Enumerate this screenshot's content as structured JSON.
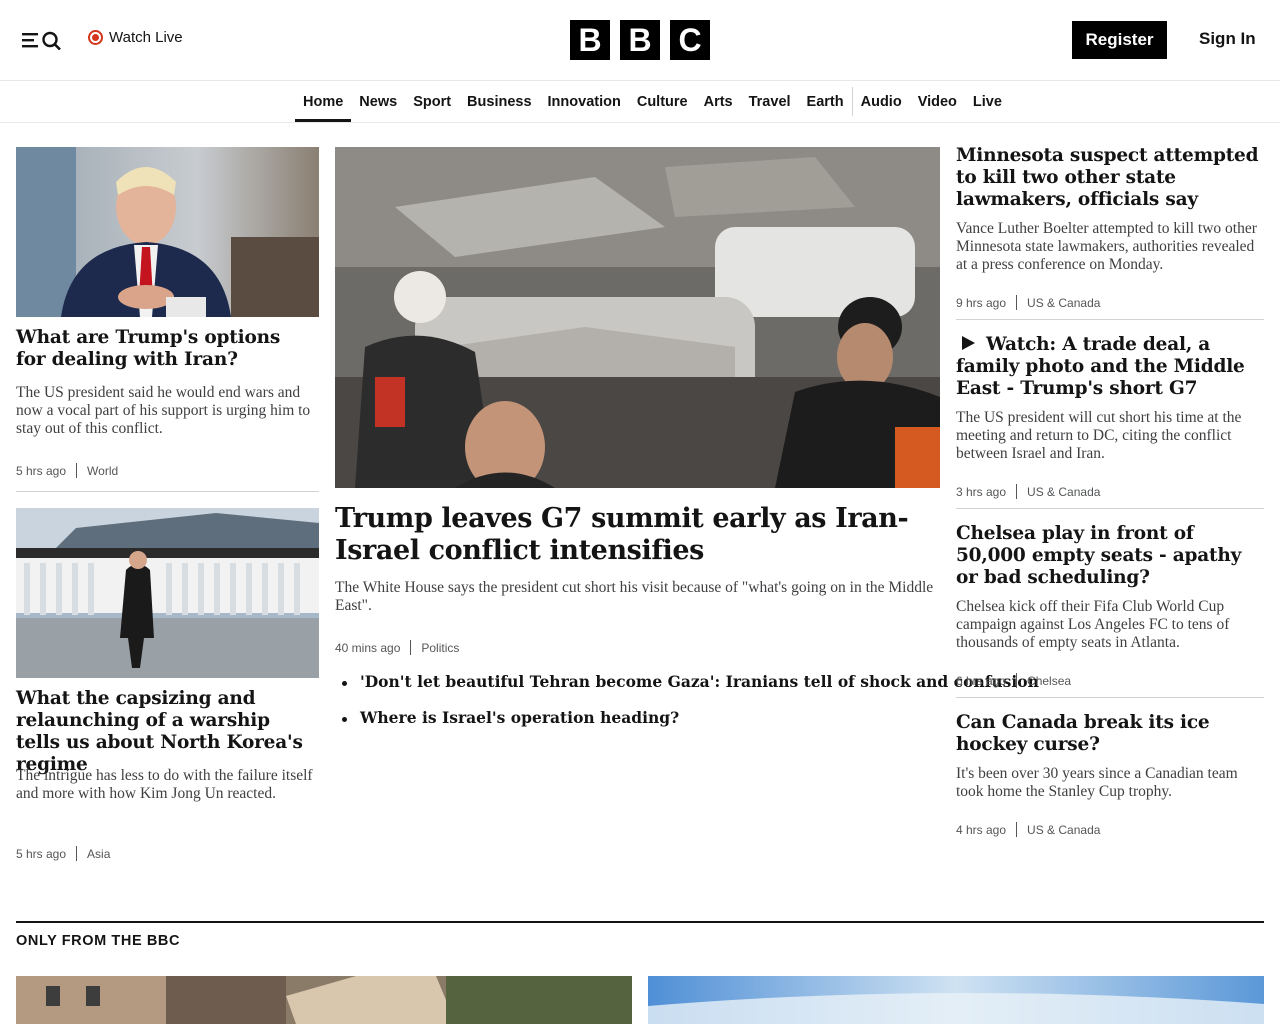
{
  "header": {
    "watch_live": "Watch Live",
    "logo_letters": [
      "B",
      "B",
      "C"
    ],
    "register": "Register",
    "sign_in": "Sign In"
  },
  "nav": {
    "items": [
      "Home",
      "News",
      "Sport",
      "Business",
      "Innovation",
      "Culture",
      "Arts",
      "Travel",
      "Earth",
      "Audio",
      "Video",
      "Live"
    ],
    "active": "Home"
  },
  "left_stories": [
    {
      "headline": "What are Trump's options for dealing with Iran?",
      "summary": "The US president said he would end wars and now a vocal part of his support is urging him to stay out of this conflict.",
      "time": "5 hrs ago",
      "category": "World"
    },
    {
      "headline": "What the capsizing and relaunching of a warship tells us about North Korea's regime",
      "summary": "The intrigue has less to do with the failure itself and more with how Kim Jong Un reacted.",
      "time": "5 hrs ago",
      "category": "Asia"
    }
  ],
  "main_story": {
    "headline": "Trump leaves G7 summit early as Iran-Israel conflict intensifies",
    "summary": "The White House says the president cut short his visit because of \"what's going on in the Middle East\".",
    "time": "40 mins ago",
    "category": "Politics",
    "related": [
      "'Don't let beautiful Tehran become Gaza': Iranians tell of shock and confusion",
      "Where is Israel's operation heading?"
    ]
  },
  "right_stories": [
    {
      "headline": "Minnesota suspect attempted to kill two other state lawmakers, officials say",
      "summary": "Vance Luther Boelter attempted to kill two other Minnesota state lawmakers, authorities revealed at a press conference on Monday.",
      "time": "9 hrs ago",
      "category": "US & Canada"
    },
    {
      "headline": "Watch: A trade deal, a family photo and the Middle East - Trump's short G7",
      "summary": "The US president will cut short his time at the meeting and return to DC, citing the conflict between Israel and Iran.",
      "time": "3 hrs ago",
      "category": "US & Canada"
    },
    {
      "headline": "Chelsea play in front of 50,000 empty seats - apathy or bad scheduling?",
      "summary": "Chelsea kick off their Fifa Club World Cup campaign against Los Angeles FC to tens of thousands of empty seats in Atlanta.",
      "time": "6 hrs ago",
      "category": "Chelsea"
    },
    {
      "headline": "Can Canada break its ice hockey curse?",
      "summary": "It's been over 30 years since a Canadian team took home the Stanley Cup trophy.",
      "time": "4 hrs ago",
      "category": "US & Canada"
    }
  ],
  "section": {
    "title": "ONLY FROM THE BBC"
  },
  "colors": {
    "live_red": "#d4351c",
    "text": "#141414",
    "meta": "#545658",
    "divider": "#d0d2d3"
  },
  "icons": [
    "menu-icon",
    "search-icon",
    "live-dot-icon",
    "play-icon"
  ]
}
